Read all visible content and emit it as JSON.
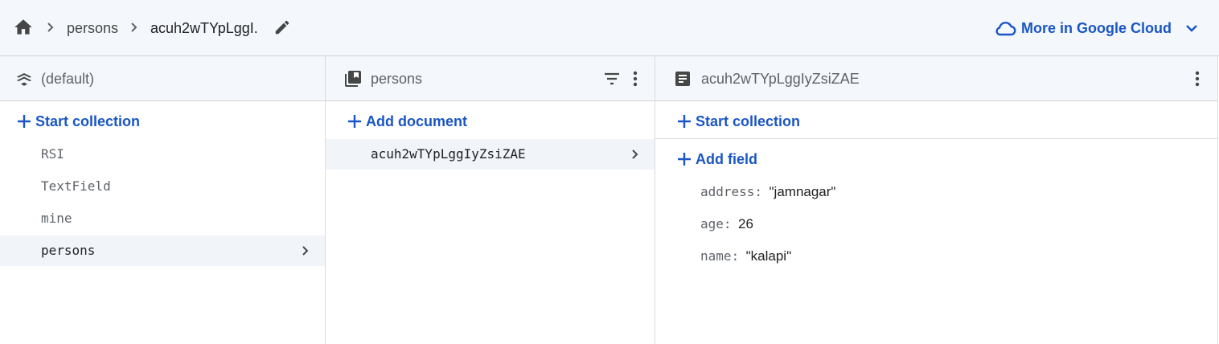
{
  "colors": {
    "accent": "#1a56c4",
    "icon_gray": "#444746",
    "bar_bg": "#f4f7fb",
    "selected_bg": "#f1f4f9"
  },
  "breadcrumb": {
    "home_icon": "home-icon",
    "items": [
      {
        "label": "persons"
      },
      {
        "label": "acuh2wTYpLggI."
      }
    ],
    "edit_icon": "pencil-icon"
  },
  "google_cloud": {
    "label": "More in Google Cloud",
    "icon": "cloud-icon",
    "chevron": "chevron-down-icon"
  },
  "root_panel": {
    "icon": "firestore-database-icon",
    "title": "(default)",
    "action_label": "Start collection",
    "collections": [
      {
        "name": "RSI",
        "selected": false
      },
      {
        "name": "TextField",
        "selected": false
      },
      {
        "name": "mine",
        "selected": false
      },
      {
        "name": "persons",
        "selected": true
      }
    ]
  },
  "collection_panel": {
    "icon": "collection-icon",
    "title": "persons",
    "action_label": "Add document",
    "documents": [
      {
        "id": "acuh2wTYpLggIyZsiZAE",
        "selected": true
      }
    ]
  },
  "document_panel": {
    "icon": "document-icon",
    "title": "acuh2wTYpLggIyZsiZAE",
    "start_collection_label": "Start collection",
    "add_field_label": "Add field",
    "fields": [
      {
        "key": "address:",
        "value": "\"jamnagar\""
      },
      {
        "key": "age:",
        "value": "26"
      },
      {
        "key": "name:",
        "value": "\"kalapi\""
      }
    ]
  }
}
